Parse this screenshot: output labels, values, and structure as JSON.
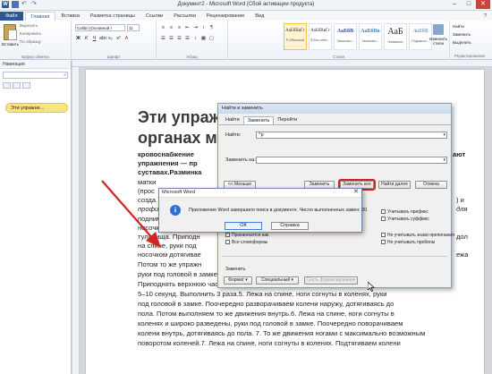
{
  "window": {
    "title": "Документ2 - Microsoft Word (Сбой активации продукта)",
    "word_logo": "W",
    "minimize": "–",
    "maximize": "□",
    "close": "✕",
    "help": "?"
  },
  "ribbon_tabs": [
    "Файл",
    "Главная",
    "Вставка",
    "Разметка страницы",
    "Ссылки",
    "Рассылки",
    "Рецензирование",
    "Вид"
  ],
  "ribbon": {
    "clipboard": {
      "paste": "Вставить",
      "cut": "Вырезать",
      "copy": "Копировать",
      "format_painter": "По образцу",
      "group_label": "Буфер обмена"
    },
    "font": {
      "family": "Calibri (Основной т",
      "size": "11",
      "group_label": "Шрифт"
    },
    "paragraph": {
      "group_label": "Абзац"
    },
    "styles": {
      "items": [
        {
          "sample": "АаБбВвГг",
          "name": "¶ Обычный"
        },
        {
          "sample": "АаБбВвГг",
          "name": "¶ Без инте..."
        },
        {
          "sample": "АаБбВ",
          "name": "Заголово..."
        },
        {
          "sample": "АаБбВв",
          "name": "Заголово..."
        },
        {
          "sample": "АаБ",
          "name": "Название"
        },
        {
          "sample": "АаБбВ",
          "name": "Подзагол..."
        }
      ],
      "change_styles": "Изменить стили",
      "group_label": "Стили"
    },
    "editing": {
      "find": "Найти",
      "replace": "Заменить",
      "select": "Выделить",
      "group_label": "Редактирование"
    }
  },
  "nav_pane": {
    "title": "Навигация",
    "search_value": "",
    "result": "Эти упражне..."
  },
  "document": {
    "heading1": "Эти упраж",
    "heading2": "органах м",
    "right_fragments": [
      "ают",
      ") и",
      "для",
      "дол",
      "ежа"
    ],
    "lines": [
      "кровоснабжение",
      "упражнения — пр",
      "суставах.Разминка",
      "матки",
      "(прос",
      "созда",
      "профи",
      "поднимаем прямую",
      "носочка ноги проти",
      "туловища. Приподн",
      "на спине, руки под",
      "носочком дотягивае",
      "Потом то же упражн",
      "руки под головой в замке. Носки потянуть на себя с напряжением в мышцах ног.",
      "Приподнять верхнюю часть туловища и посмотреть на носки. Удерживать туловище",
      "5–10  секунд. Выполнить 3  раза.5. Лежа на спине, ноги согнуты в коленях, руки",
      "под головой в замке. Поочередно разворачиваем колени наружу, дотягиваясь до",
      "пола. Потом выполняем то же движения внутрь.6. Лежа на спине, ноги согнуты в",
      "коленях и широко разведены, руки под головой в замке. Поочередно поворачиваем",
      "колени внутрь, дотягиваясь до пола. 7. То же движения ногами с максимально возможным",
      "поворотом коленей.7. Лежа на спине, ноги согнуты в коленях. Подтягиваем колени"
    ]
  },
  "find_replace": {
    "title": "Найти и заменить",
    "tabs": [
      "Найти",
      "Заменить",
      "Перейти"
    ],
    "find_label": "Найти:",
    "find_value": "^p",
    "replace_label": "Заменить на:",
    "replace_value": "",
    "buttons": {
      "less": "<< Меньше",
      "replace": "Заменить",
      "replace_all": "Заменить все",
      "find_next": "Найти далее",
      "cancel": "Отмена",
      "format": "Формат ▾",
      "special": "Специальный ▾",
      "no_format": "Снять форматирование"
    },
    "options": {
      "prefix": "Учитывать префикс",
      "suffix": "Учитывать суффикс",
      "punctuation": "Не учитывать знаки препинания",
      "spaces": "Не учитывать пробелы",
      "sounds_like": "Произносится как",
      "all_forms": "Все словоформы"
    },
    "replace_section": "Заменить"
  },
  "message_box": {
    "title": "Microsoft Word",
    "text": "Приложение Word завершило поиск в документе. Число выполненных замен: 20.",
    "ok": "ОК",
    "help": "Справка",
    "close": "✕",
    "icon": "i"
  },
  "colors": {
    "word_blue": "#2b5797",
    "highlight_red": "#d42323",
    "nav_result_yellow": "#f9e483"
  }
}
